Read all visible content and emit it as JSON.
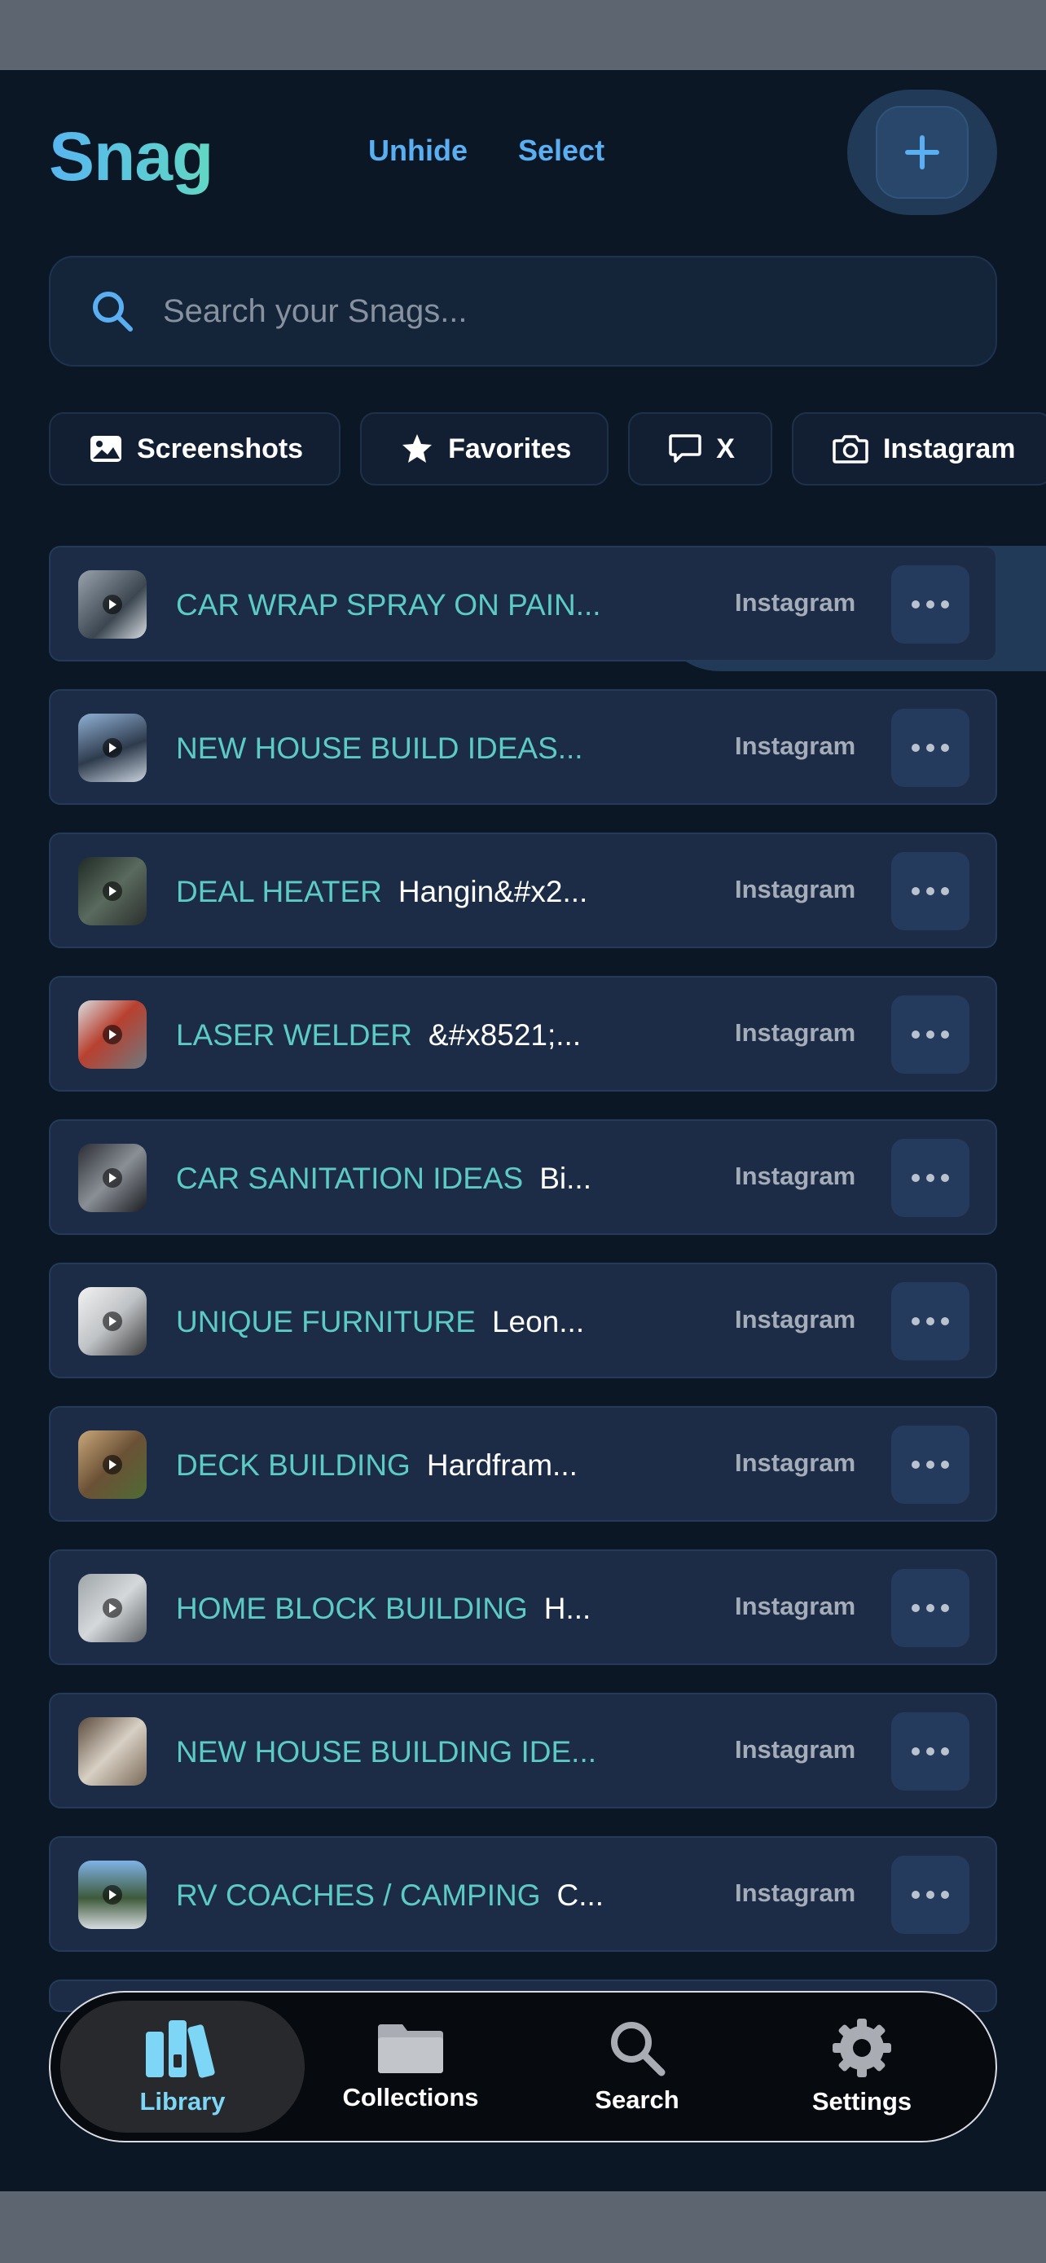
{
  "header": {
    "app_name": "Snag",
    "unhide_label": "Unhide",
    "select_label": "Select",
    "list_icon": "list-icon",
    "add_icon": "plus-icon"
  },
  "search": {
    "placeholder": "Search your Snags...",
    "value": ""
  },
  "filters": [
    {
      "label": "Screenshots",
      "icon": "image-icon"
    },
    {
      "label": "Favorites",
      "icon": "star-icon"
    },
    {
      "label": "X",
      "icon": "speech-bubble-icon"
    },
    {
      "label": "Instagram",
      "icon": "camera-icon"
    }
  ],
  "items": [
    {
      "title": "CAR WRAP SPRAY ON PAIN...",
      "subtitle": "",
      "source": "Instagram"
    },
    {
      "title": "NEW HOUSE BUILD IDEAS...",
      "subtitle": "",
      "source": "Instagram"
    },
    {
      "title": "DEAL HEATER",
      "subtitle": "Hangin&#x2...",
      "source": "Instagram"
    },
    {
      "title": "LASER WELDER",
      "subtitle": "&#x8521;...",
      "source": "Instagram"
    },
    {
      "title": "CAR SANITATION IDEAS",
      "subtitle": "Bi...",
      "source": "Instagram"
    },
    {
      "title": "UNIQUE FURNITURE",
      "subtitle": "Leon...",
      "source": "Instagram"
    },
    {
      "title": "DECK BUILDING",
      "subtitle": "Hardfram...",
      "source": "Instagram"
    },
    {
      "title": "HOME BLOCK BUILDING",
      "subtitle": "H...",
      "source": "Instagram"
    },
    {
      "title": "NEW HOUSE BUILDING IDE...",
      "subtitle": "",
      "source": "Instagram"
    },
    {
      "title": "RV COACHES / CAMPING",
      "subtitle": "C...",
      "source": "Instagram"
    }
  ],
  "tabs": [
    {
      "label": "Library",
      "icon": "library-books-icon",
      "active": true
    },
    {
      "label": "Collections",
      "icon": "folder-icon",
      "active": false
    },
    {
      "label": "Search",
      "icon": "search-icon",
      "active": false
    },
    {
      "label": "Settings",
      "icon": "gear-icon",
      "active": false
    }
  ],
  "colors": {
    "background": "#0c1726",
    "row": "#1c2c47",
    "accent_blue": "#5aaef2",
    "accent_teal": "#5ccbc4"
  }
}
